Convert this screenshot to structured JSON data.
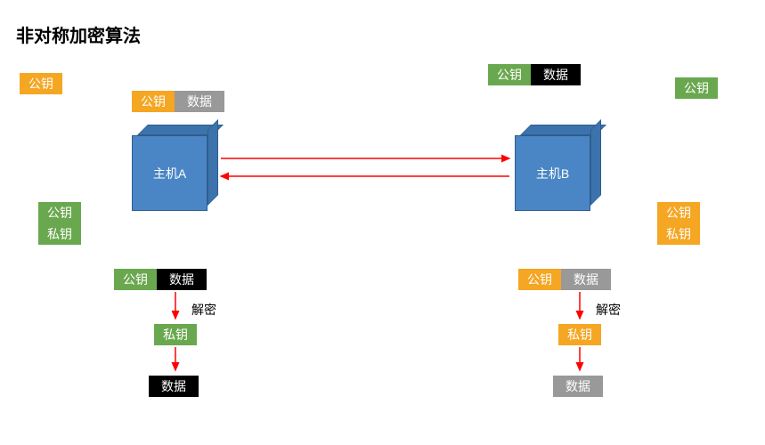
{
  "title": "非对称加密算法",
  "labels": {
    "public_key": "公钥",
    "private_key": "私钥",
    "data": "数据",
    "decrypt": "解密",
    "host_a": "主机A",
    "host_b": "主机B"
  },
  "colors": {
    "orange": "#f5a623",
    "green": "#6aa84f",
    "black": "#000000",
    "gray": "#999999",
    "cube_front": "#4a86c5",
    "cube_shade": "#3d73ad",
    "arrow": "#ff0000"
  },
  "chart_data": {
    "type": "diagram",
    "title": "非对称加密算法",
    "nodes": [
      {
        "id": "hostA",
        "label": "主机A",
        "keys": [
          "公钥",
          "私钥"
        ]
      },
      {
        "id": "hostB",
        "label": "主机B",
        "keys": [
          "公钥",
          "私钥"
        ]
      }
    ],
    "edges": [
      {
        "from": "hostA",
        "to": "hostB",
        "label": "公钥+数据"
      },
      {
        "from": "hostB",
        "to": "hostA",
        "label": "公钥+数据"
      }
    ],
    "decrypt_flows": [
      {
        "host": "hostA",
        "input": "公钥+数据",
        "action": "解密",
        "key": "私钥",
        "output": "数据"
      },
      {
        "host": "hostB",
        "input": "公钥+数据",
        "action": "解密",
        "key": "私钥",
        "output": "数据"
      }
    ],
    "floating_tags": [
      {
        "text": "公钥",
        "color": "orange",
        "pos": "top-left"
      },
      {
        "text": "公钥+数据 (green/black)",
        "pos": "top-right"
      },
      {
        "text": "公钥",
        "color": "green",
        "pos": "top-far-right"
      }
    ]
  }
}
